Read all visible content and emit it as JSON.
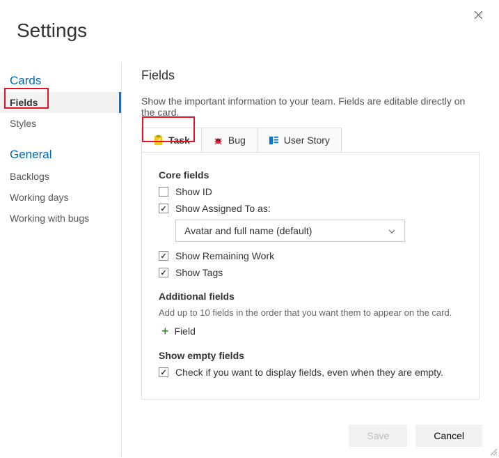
{
  "page_title": "Settings",
  "sidebar": {
    "section_cards": "Cards",
    "item_fields": "Fields",
    "item_styles": "Styles",
    "section_general": "General",
    "item_backlogs": "Backlogs",
    "item_working_days": "Working days",
    "item_working_bugs": "Working with bugs"
  },
  "main": {
    "title": "Fields",
    "description": "Show the important information to your team. Fields are editable directly on the card."
  },
  "tabs": {
    "task": "Task",
    "bug": "Bug",
    "user_story": "User Story"
  },
  "core": {
    "header": "Core fields",
    "show_id": "Show ID",
    "show_assigned": "Show Assigned To as:",
    "assigned_value": "Avatar and full name (default)",
    "show_remaining": "Show Remaining Work",
    "show_tags": "Show Tags"
  },
  "additional": {
    "header": "Additional fields",
    "sub": "Add up to 10 fields in the order that you want them to appear on the card.",
    "add_field": "Field"
  },
  "empty": {
    "header": "Show empty fields",
    "check_label": "Check if you want to display fields, even when they are empty."
  },
  "footer": {
    "save": "Save",
    "cancel": "Cancel"
  }
}
